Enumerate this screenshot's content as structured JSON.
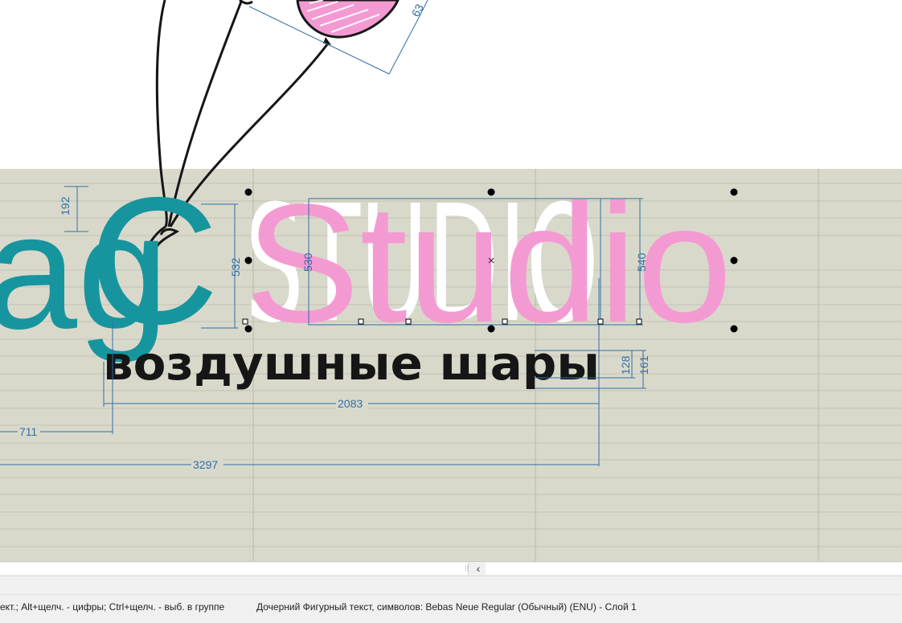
{
  "canvas": {
    "colors": {
      "paper_bg": "#d9d9cb",
      "teal": "#17959e",
      "pink": "#f49ad3",
      "white_text": "#ffffff",
      "dimension": "#2f6fa7",
      "black": "#161616"
    },
    "logo": {
      "left_fragment": "ag",
      "teal_letter": "C",
      "studio_word": "Studio",
      "white_word": "STUDIO",
      "tagline": "воздушные шары"
    },
    "dimensions": {
      "d192": "192",
      "d532": "532",
      "d530": "530",
      "d540": "540",
      "d128": "128",
      "d161": "161",
      "d2083": "2083",
      "d711": "711",
      "d3297": "3297",
      "d63": "63"
    }
  },
  "scrollbar": {
    "grip": "⁞⁞",
    "left_arrow": "‹"
  },
  "statusbar": {
    "hint": "ект.; Alt+щелч. - цифры; Ctrl+щелч. - выб. в группе",
    "selection_info": "Дочерний Фигурный текст, символов: Bebas Neue Regular (Обычный) (ENU) - Слой 1"
  }
}
